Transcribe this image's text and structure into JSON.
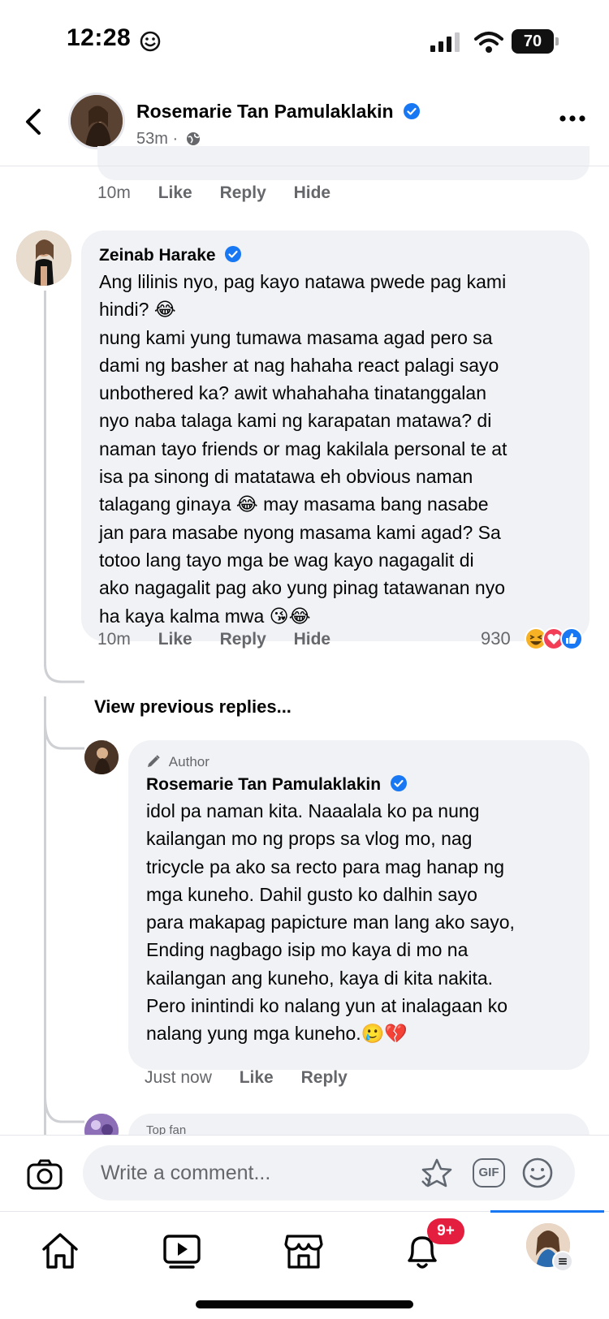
{
  "status_bar": {
    "time": "12:28",
    "battery": "70"
  },
  "post_header": {
    "author": "Rosemarie Tan Pamulaklakin",
    "time_ago": "53m",
    "separator": "·"
  },
  "previous_comment": {
    "time_ago": "10m",
    "like": "Like",
    "reply": "Reply",
    "hide": "Hide"
  },
  "comment": {
    "author": "Zeinab Harake",
    "text": "Ang lilinis nyo, pag kayo natawa pwede pag kami\nhindi? 😂\nnung kami yung tumawa masama agad pero sa\ndami ng basher at nag hahaha react palagi sayo\nunbothered ka? awit whahahaha tinatanggalan\nnyo naba talaga kami ng karapatan matawa? di\nnaman tayo friends or mag kakilala personal te at\nisa pa sinong di matatawa eh obvious naman\ntalagang ginaya 😂 may masama bang nasabe\njan para masabe nyong masama kami agad? Sa\ntotoo lang tayo mga be wag kayo nagagalit di\nako nagagalit pag ako yung pinag tatawanan nyo\nha kaya kalma mwa 😘😂",
    "time_ago": "10m",
    "like": "Like",
    "reply": "Reply",
    "hide": "Hide",
    "reaction_count": "930",
    "reactions": [
      "haha-icon",
      "love-icon",
      "like-icon"
    ]
  },
  "view_previous_replies": "View previous replies...",
  "reply": {
    "badge": "Author",
    "author": "Rosemarie Tan Pamulaklakin",
    "text": "idol pa naman kita. Naaalala ko pa nung\nkailangan mo ng props sa vlog mo, nag\ntricycle pa ako sa recto para mag hanap ng\nmga kuneho. Dahil gusto ko dalhin sayo\npara makapag papicture man lang ako sayo,\nEnding nagbago isip mo kaya di mo na\nkailangan ang kuneho, kaya di kita nakita.\nPero inintindi ko nalang yun at inalagaan ko\nnalang yung mga kuneho.🥲💔",
    "time_ago": "Just now",
    "like": "Like",
    "reply": "Reply"
  },
  "next_reply": {
    "badge": "Top fan"
  },
  "composer": {
    "placeholder": "Write a comment...",
    "gif_label": "GIF"
  },
  "bottom_nav": {
    "items": [
      "home-icon",
      "video-icon",
      "marketplace-icon",
      "notifications-icon",
      "profile-avatar"
    ],
    "notification_badge": "9+",
    "active_color": "#1877f2"
  },
  "colors": {
    "bubble": "#f0f2f5",
    "secondary_text": "#65676b",
    "verified": "#1877f2",
    "badge": "#e41e3f"
  }
}
